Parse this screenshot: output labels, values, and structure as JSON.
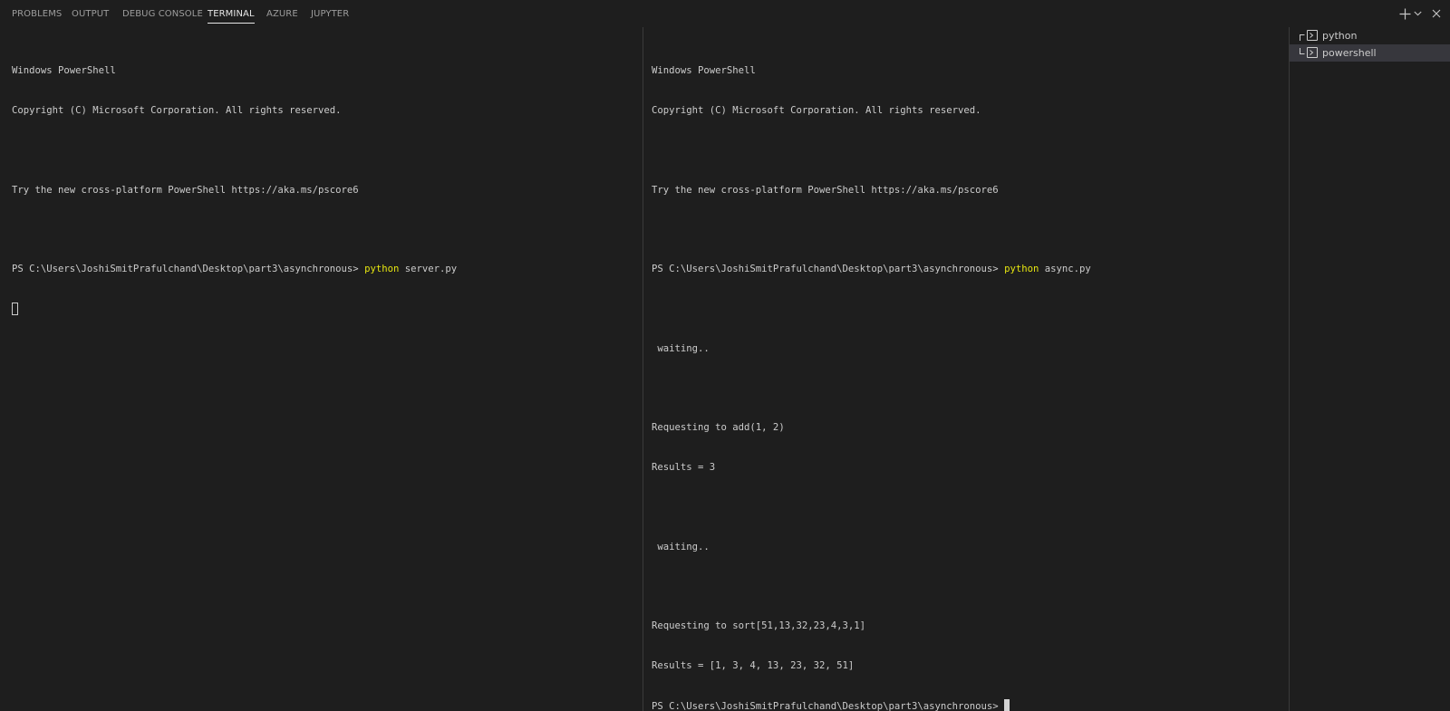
{
  "tabs": [
    {
      "label": "PROBLEMS",
      "active": false
    },
    {
      "label": "OUTPUT",
      "active": false
    },
    {
      "label": "DEBUG CONSOLE",
      "active": false
    },
    {
      "label": "TERMINAL",
      "active": true
    },
    {
      "label": "AZURE",
      "active": false
    },
    {
      "label": "JUPYTER",
      "active": false
    }
  ],
  "actions": {
    "new_terminal_icon": "plus-icon",
    "dropdown_icon": "chevron-down-icon",
    "close_icon": "close-icon"
  },
  "left_terminal": {
    "lines": [
      "Windows PowerShell",
      "Copyright (C) Microsoft Corporation. All rights reserved.",
      "",
      "Try the new cross-platform PowerShell https://aka.ms/pscore6",
      ""
    ],
    "prompt": "PS C:\\Users\\JoshiSmitPrafulchand\\Desktop\\part3\\asynchronous> ",
    "command": "python",
    "command_args": " server.py"
  },
  "right_terminal": {
    "header_lines": [
      "Windows PowerShell",
      "Copyright (C) Microsoft Corporation. All rights reserved.",
      "",
      "Try the new cross-platform PowerShell https://aka.ms/pscore6",
      ""
    ],
    "prompt": "PS C:\\Users\\JoshiSmitPrafulchand\\Desktop\\part3\\asynchronous> ",
    "command": "python",
    "command_args": " async.py",
    "output_lines": [
      "",
      " waiting..",
      "",
      "Requesting to add(1, 2)",
      "Results = 3",
      "",
      " waiting..",
      "",
      "Requesting to sort[51,13,32,23,4,3,1]",
      "Results = [1, 3, 4, 13, 23, 32, 51]"
    ],
    "final_prompt": "PS C:\\Users\\JoshiSmitPrafulchand\\Desktop\\part3\\asynchronous> "
  },
  "terminal_list": [
    {
      "label": "python",
      "icon": "terminal-icon",
      "selected": false
    },
    {
      "label": "powershell",
      "icon": "terminal-icon",
      "selected": true
    }
  ],
  "colors": {
    "background": "#1e1e1e",
    "text": "#cccccc",
    "command": "#e5e510",
    "selected_item": "#37373d"
  }
}
